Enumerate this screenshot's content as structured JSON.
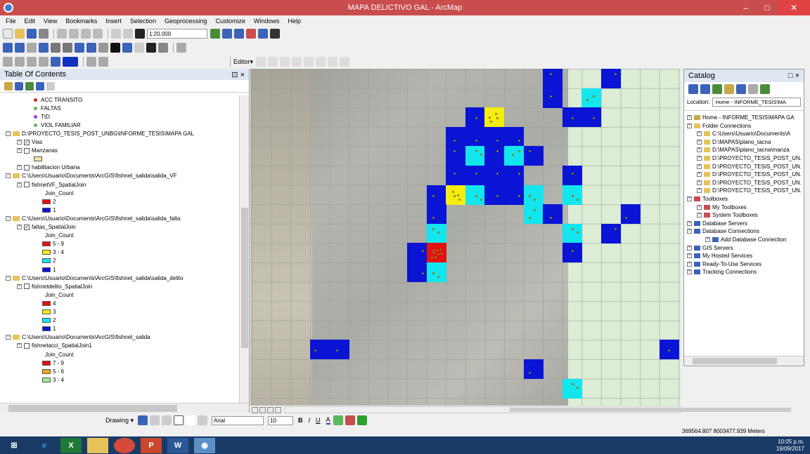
{
  "window": {
    "title": "MAPA DELICTIVO GAL - ArcMap",
    "minimize": "–",
    "maximize": "□",
    "close": "✕"
  },
  "menu": [
    "File",
    "Edit",
    "View",
    "Bookmarks",
    "Insert",
    "Selection",
    "Geoprocessing",
    "Customize",
    "Windows",
    "Help"
  ],
  "toolbar": {
    "scale": "1:20.000",
    "editor": "Editor▾"
  },
  "toc": {
    "title": "Table Of Contents",
    "pin": "⊡ ×",
    "layers": [
      {
        "kind": "legend-dot",
        "label": "ACC TRANSITO",
        "color": "#d62828",
        "indent": 48
      },
      {
        "kind": "legend-dot",
        "label": "FALTAS",
        "color": "#5cb85c",
        "indent": 48
      },
      {
        "kind": "legend-dot",
        "label": "TID",
        "color": "#a03ccf",
        "indent": 48
      },
      {
        "kind": "legend-dot",
        "label": "VIOL FAMILIAR",
        "color": "#5cb85c",
        "indent": 48
      },
      {
        "kind": "group",
        "label": "D:\\PROYECTO_TESIS_POST_UNBG\\INFORME_TESIS\\MAPA GAL",
        "indent": 8
      },
      {
        "kind": "layer",
        "label": "Vias",
        "checked": "☑",
        "indent": 24
      },
      {
        "kind": "layer",
        "label": "Manzanas",
        "checked": "",
        "indent": 24
      },
      {
        "kind": "swatch",
        "label": "",
        "color": "#f7e4a8",
        "indent": 48
      },
      {
        "kind": "layer",
        "label": "habilitacion Urbana",
        "checked": "",
        "indent": 24
      },
      {
        "kind": "group",
        "label": "C:\\Users\\Usuario\\Documents\\ArcGIS\\fishnet_salida\\salida_VF",
        "indent": 8
      },
      {
        "kind": "layer",
        "label": "fishnetVF_SpatialJoin",
        "checked": "",
        "indent": 24
      },
      {
        "kind": "text",
        "label": "Join_Count",
        "indent": 64
      },
      {
        "kind": "swatch",
        "label": "2",
        "color": "#e3110f",
        "indent": 60
      },
      {
        "kind": "swatch",
        "label": "1",
        "color": "#0a14d4",
        "indent": 60
      },
      {
        "kind": "group",
        "label": "C:\\Users\\Usuario\\Documents\\ArcGIS\\fishnet_salida\\salida_falta",
        "indent": 8
      },
      {
        "kind": "layer",
        "label": "faltas_SpatialJoin",
        "checked": "☑",
        "indent": 24
      },
      {
        "kind": "text",
        "label": "Join_Count",
        "indent": 64
      },
      {
        "kind": "swatch",
        "label": "5 - 9",
        "color": "#e3110f",
        "indent": 60
      },
      {
        "kind": "swatch",
        "label": "3 - 4",
        "color": "#f5ec10",
        "indent": 60
      },
      {
        "kind": "swatch",
        "label": "2",
        "color": "#14e6f0",
        "indent": 60
      },
      {
        "kind": "swatch",
        "label": "1",
        "color": "#0a14d4",
        "indent": 60
      },
      {
        "kind": "group",
        "label": "C:\\Users\\Usuario\\Documents\\ArcGIS\\fishnet_salida\\salida_delito",
        "indent": 8
      },
      {
        "kind": "layer",
        "label": "fishnetdelito_SpatialJoin",
        "checked": "",
        "indent": 24
      },
      {
        "kind": "text",
        "label": "Join_Count",
        "indent": 64
      },
      {
        "kind": "swatch",
        "label": "4",
        "color": "#e3110f",
        "indent": 60
      },
      {
        "kind": "swatch",
        "label": "3",
        "color": "#f5ec10",
        "indent": 60
      },
      {
        "kind": "swatch",
        "label": "2",
        "color": "#14e6f0",
        "indent": 60
      },
      {
        "kind": "swatch",
        "label": "1",
        "color": "#0a14d4",
        "indent": 60
      },
      {
        "kind": "group",
        "label": "C:\\Users\\Usuario\\Documents\\ArcGIS\\fishnet_salida",
        "indent": 8
      },
      {
        "kind": "layer",
        "label": "fishnetacci_SpatialJoin1",
        "checked": "",
        "indent": 24
      },
      {
        "kind": "text",
        "label": "Join_Count",
        "indent": 64
      },
      {
        "kind": "swatch",
        "label": "7 - 9",
        "color": "#e3110f",
        "indent": 60
      },
      {
        "kind": "swatch",
        "label": "5 - 6",
        "color": "#f0a81a",
        "indent": 60
      },
      {
        "kind": "swatch",
        "label": "3 - 4",
        "color": "#a6e8a0",
        "indent": 60
      }
    ]
  },
  "map": {
    "colors": {
      "1": "#0a14d4",
      "2": "#14e6f0",
      "3": "#f5ec10",
      "5": "#e3110f"
    },
    "cells": [
      [
        12,
        0,
        1
      ],
      [
        15,
        0,
        1
      ],
      [
        12,
        1,
        1
      ],
      [
        14,
        1,
        2
      ],
      [
        8,
        2,
        1
      ],
      [
        9,
        2,
        3
      ],
      [
        13,
        2,
        1
      ],
      [
        14,
        2,
        1
      ],
      [
        7,
        3,
        1
      ],
      [
        8,
        3,
        1
      ],
      [
        9,
        3,
        1
      ],
      [
        10,
        3,
        1
      ],
      [
        7,
        4,
        1
      ],
      [
        8,
        4,
        2
      ],
      [
        9,
        4,
        1
      ],
      [
        10,
        4,
        2
      ],
      [
        11,
        4,
        1
      ],
      [
        7,
        5,
        1
      ],
      [
        8,
        5,
        1
      ],
      [
        9,
        5,
        1
      ],
      [
        10,
        5,
        1
      ],
      [
        13,
        5,
        1
      ],
      [
        6,
        6,
        1
      ],
      [
        7,
        6,
        3
      ],
      [
        8,
        6,
        2
      ],
      [
        9,
        6,
        1
      ],
      [
        10,
        6,
        1
      ],
      [
        11,
        6,
        2
      ],
      [
        13,
        6,
        2
      ],
      [
        6,
        7,
        1
      ],
      [
        11,
        7,
        2
      ],
      [
        12,
        7,
        1
      ],
      [
        16,
        7,
        1
      ],
      [
        6,
        8,
        2
      ],
      [
        13,
        8,
        2
      ],
      [
        15,
        8,
        1
      ],
      [
        5,
        9,
        1
      ],
      [
        6,
        9,
        5
      ],
      [
        13,
        9,
        1
      ],
      [
        5,
        10,
        1
      ],
      [
        6,
        10,
        2
      ],
      [
        0,
        14,
        1
      ],
      [
        1,
        14,
        1
      ],
      [
        18,
        14,
        1
      ],
      [
        11,
        15,
        1
      ],
      [
        13,
        16,
        2
      ]
    ]
  },
  "catalog": {
    "title": "Catalog",
    "controls": "□ ×",
    "location_label": "Location:",
    "location_value": "Home - INFORME_TESIS\\MA",
    "items": [
      {
        "label": "Home - INFORME_TESIS\\MAPA GA",
        "indent": 4,
        "icon": "home"
      },
      {
        "label": "Folder Connections",
        "indent": 4,
        "icon": "folder"
      },
      {
        "label": "C:\\Users\\Usuario\\Documents\\A",
        "indent": 18,
        "icon": "folder"
      },
      {
        "label": "D:\\MAPAS\\plano_tacna",
        "indent": 18,
        "icon": "folder"
      },
      {
        "label": "D:\\MAPAS\\plano_tacna\\manza",
        "indent": 18,
        "icon": "folder"
      },
      {
        "label": "D:\\PROYECTO_TESIS_POST_UN.",
        "indent": 18,
        "icon": "folder"
      },
      {
        "label": "D:\\PROYECTO_TESIS_POST_UN.",
        "indent": 18,
        "icon": "folder"
      },
      {
        "label": "D:\\PROYECTO_TESIS_POST_UN.",
        "indent": 18,
        "icon": "folder"
      },
      {
        "label": "D:\\PROYECTO_TESIS_POST_UN.",
        "indent": 18,
        "icon": "folder"
      },
      {
        "label": "D:\\PROYECTO_TESIS_POST_UN.",
        "indent": 18,
        "icon": "folder"
      },
      {
        "label": "Toolboxes",
        "indent": 4,
        "icon": "toolbox"
      },
      {
        "label": "My Toolboxes",
        "indent": 18,
        "icon": "toolbox"
      },
      {
        "label": "System Toolboxes",
        "indent": 18,
        "icon": "toolbox"
      },
      {
        "label": "Database Servers",
        "indent": 4,
        "icon": "db"
      },
      {
        "label": "Database Connections",
        "indent": 4,
        "icon": "db"
      },
      {
        "label": "Add Database Connection",
        "indent": 30,
        "icon": "db"
      },
      {
        "label": "GIS Servers",
        "indent": 4,
        "icon": "db"
      },
      {
        "label": "My Hosted Services",
        "indent": 4,
        "icon": "db"
      },
      {
        "label": "Ready-To-Use Services",
        "indent": 4,
        "icon": "db"
      },
      {
        "label": "Tracking Connections",
        "indent": 4,
        "icon": "db"
      }
    ]
  },
  "drawing": {
    "label": "Drawing ▾",
    "font": "Arial",
    "size": "10",
    "bold": "B",
    "italic": "I",
    "underline": "U",
    "fontcolor": "A"
  },
  "status": {
    "coords": "369564.807  8003477.939 Meters"
  },
  "taskbar": {
    "time": "10:05 p.m.",
    "date": "19/09/2017"
  }
}
